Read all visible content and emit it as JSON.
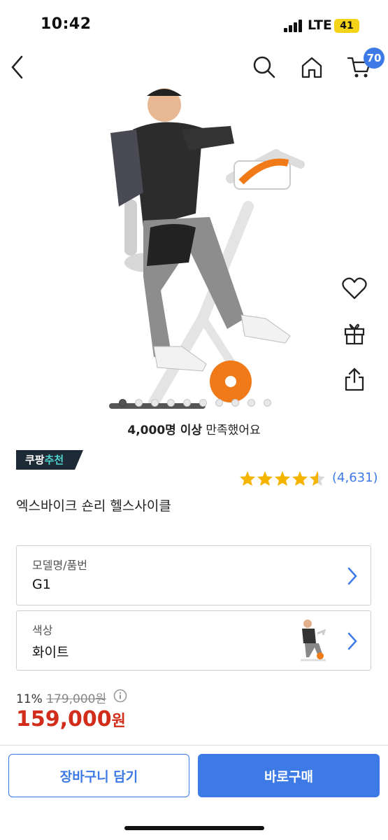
{
  "status_bar": {
    "time": "10:42",
    "network": "LTE",
    "battery": "41"
  },
  "nav": {
    "cart_count": "70"
  },
  "gallery": {
    "total_images": 10,
    "active_index": 0
  },
  "satisfaction": {
    "bold": "4,000명 이상",
    "rest": " 만족했어요"
  },
  "recommend_badge": {
    "brand": "쿠팡",
    "label": "추천"
  },
  "rating": {
    "stars": 4.5,
    "review_count": "(4,631)"
  },
  "product": {
    "title": "엑스바이크 숀리 헬스사이클"
  },
  "options": [
    {
      "label": "모델명/품번",
      "value": "G1"
    },
    {
      "label": "색상",
      "value": "화이트"
    }
  ],
  "price": {
    "discount": "11%",
    "original": "179,000원",
    "current": "159,000",
    "currency": "원"
  },
  "actions": {
    "add_to_cart": "장바구니 담기",
    "buy_now": "바로구매"
  },
  "colors": {
    "accent": "#3d7ae5",
    "price": "#d12d1a",
    "star": "#f5b400"
  }
}
